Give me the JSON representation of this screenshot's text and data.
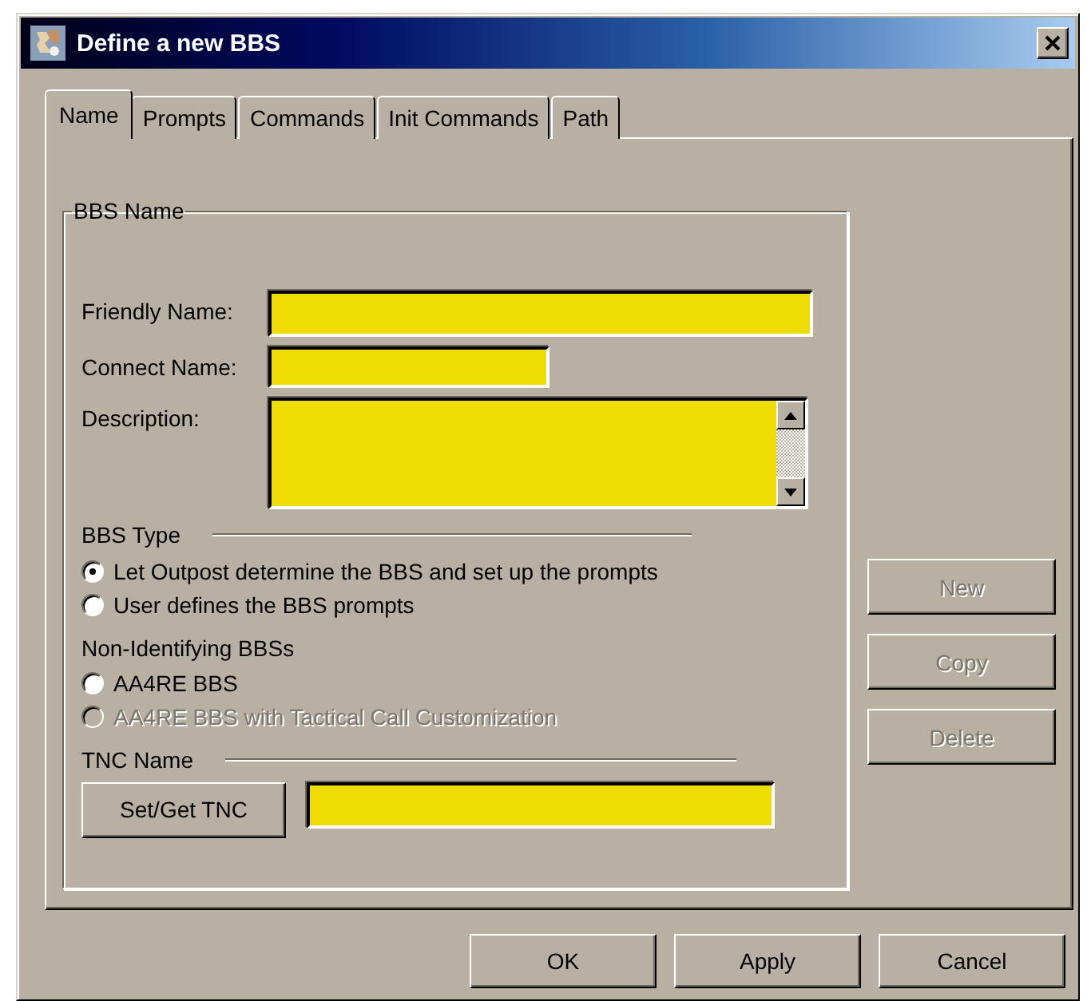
{
  "window": {
    "title": "Define a new BBS"
  },
  "tabs": [
    {
      "label": "Name",
      "selected": true
    },
    {
      "label": "Prompts",
      "selected": false
    },
    {
      "label": "Commands",
      "selected": false
    },
    {
      "label": "Init Commands",
      "selected": false
    },
    {
      "label": "Path",
      "selected": false
    }
  ],
  "group": {
    "title": "BBS Name",
    "fields": [
      {
        "label": "Friendly Name:",
        "kind": "long"
      },
      {
        "label": "Connect Name:",
        "kind": "short"
      },
      {
        "label": "Description:",
        "kind": "multiline"
      }
    ],
    "sections": [
      {
        "title": "BBS Type",
        "kind": "ruled",
        "options": [
          {
            "label": "Let Outpost determine the BBS and set up the prompts",
            "selected": true,
            "disabled": false
          },
          {
            "label": "User defines the BBS prompts",
            "selected": false,
            "disabled": false
          }
        ]
      },
      {
        "title": "Non-Identifying BBSs",
        "kind": "plain",
        "options": [
          {
            "label": "AA4RE BBS",
            "selected": false,
            "disabled": false
          },
          {
            "label": "AA4RE BBS with Tactical Call Customization",
            "selected": false,
            "disabled": true
          }
        ]
      }
    ],
    "tnc": {
      "title": "TNC Name",
      "button": "Set/Get TNC"
    }
  },
  "side_buttons": [
    {
      "label": "New",
      "disabled": true
    },
    {
      "label": "Copy",
      "disabled": true
    },
    {
      "label": "Delete",
      "disabled": true
    }
  ],
  "buttons": [
    "OK",
    "Apply",
    "Cancel"
  ]
}
